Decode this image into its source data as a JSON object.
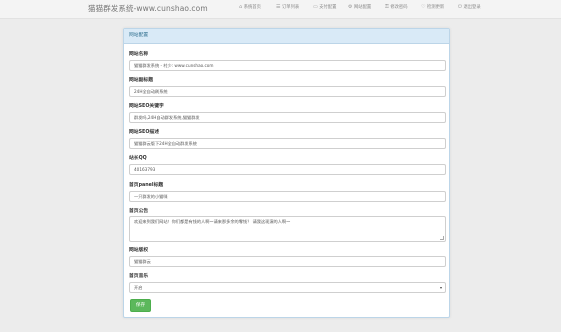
{
  "header": {
    "site_title": "猫猫群发系统-www.cunshao.com",
    "nav": [
      {
        "icon": "home-icon",
        "glyph": "⌂",
        "label": "系统首页"
      },
      {
        "icon": "list-icon",
        "glyph": "☰",
        "label": "订单列表"
      },
      {
        "icon": "card-icon",
        "glyph": "▭",
        "label": "支付配置"
      },
      {
        "icon": "settings-icon",
        "glyph": "⚙",
        "label": "网站配置"
      },
      {
        "icon": "lock-icon",
        "glyph": "⚿",
        "label": "修改密码"
      },
      {
        "icon": "update-icon",
        "glyph": "♡",
        "label": "检测更新"
      },
      {
        "icon": "logout-icon",
        "glyph": "⏻",
        "label": "退出登录"
      }
    ]
  },
  "panel": {
    "title": "网站配置",
    "fields": [
      {
        "label": "网站名称",
        "value": "猫猫群发系统 - 村少: www.cunshao.com"
      },
      {
        "label": "网站副标题",
        "value": "24H全自动刷系统"
      },
      {
        "label": "网站SEO关键字",
        "value": "群发吗,24H自动群发系统,猫猫群发"
      },
      {
        "label": "网站SEO描述",
        "value": "猫猫群云版下24H全自动群发系统"
      },
      {
        "label": "站长QQ",
        "value": "40163793"
      },
      {
        "label": "首页panel标题",
        "value": "一只群发的小猫咪"
      },
      {
        "label": "首页公告",
        "value": "欢迎来到我们网站！你们都是有钱的人啊～请来那多余的零钱？ 请我这现演的人啊～"
      },
      {
        "label": "网站版权",
        "value": "猫猫群云"
      },
      {
        "label": "首页音乐",
        "value": "开启"
      }
    ],
    "save_label": "保存"
  }
}
